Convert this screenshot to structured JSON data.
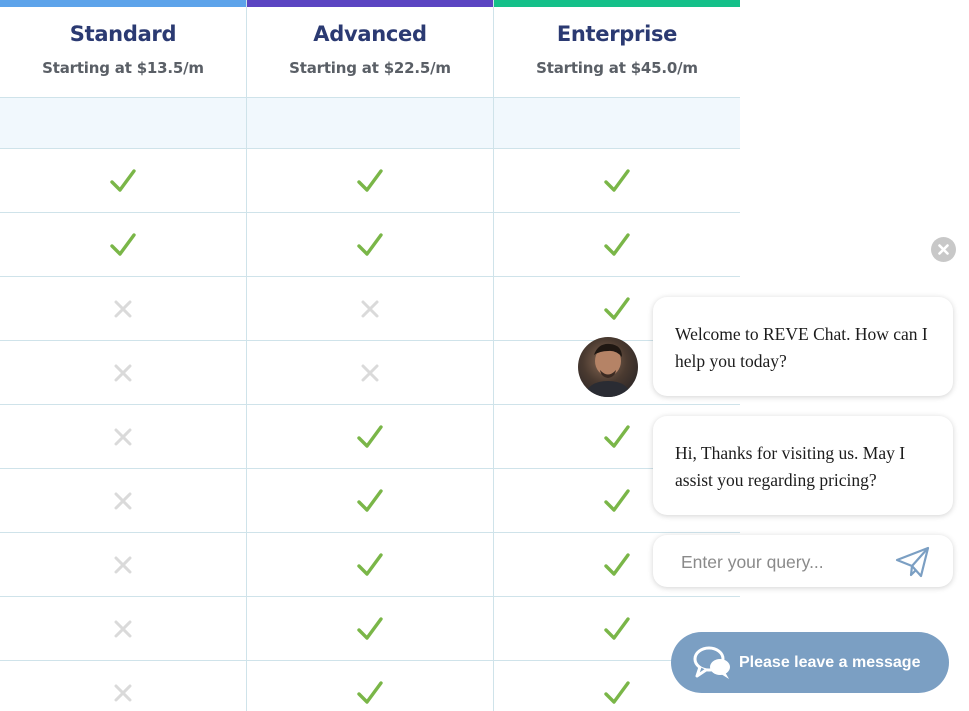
{
  "plans": [
    {
      "name": "Standard",
      "price": "Starting at $13.5/m",
      "accent": "#5da3ea"
    },
    {
      "name": "Advanced",
      "price": "Starting at $22.5/m",
      "accent": "#5b45c2"
    },
    {
      "name": "Enterprise",
      "price": "Starting at $45.0/m",
      "accent": "#14c089"
    }
  ],
  "features": [
    [
      true,
      true,
      true
    ],
    [
      true,
      true,
      true
    ],
    [
      false,
      false,
      true
    ],
    [
      false,
      false,
      true
    ],
    [
      false,
      true,
      true
    ],
    [
      false,
      true,
      true
    ],
    [
      false,
      true,
      true
    ],
    [
      false,
      true,
      true
    ],
    [
      false,
      true,
      true
    ]
  ],
  "colors": {
    "check": "#7ab648",
    "cross": "#dadada",
    "grid": "#cfe3ea",
    "band": "#f1f8fd",
    "chat_button": "#7b9fc3"
  },
  "icons": {
    "included": "check-icon",
    "excluded": "cross-icon",
    "close": "close-icon",
    "send": "send-icon",
    "chat": "chat-bubbles-icon"
  },
  "chat": {
    "messages": [
      "Welcome to REVE Chat. How can I help you today?",
      "Hi, Thanks for visiting us. May I assist you regarding pricing?"
    ],
    "input_placeholder": "Enter your query...",
    "leave_message_label": "Please leave a message"
  }
}
